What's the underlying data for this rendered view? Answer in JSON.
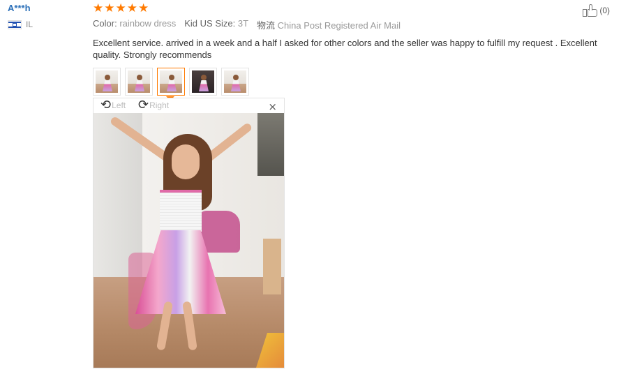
{
  "reviewer": {
    "name": "A***h",
    "country_code": "IL"
  },
  "review": {
    "rating": 5,
    "stars": [
      "★",
      "★",
      "★",
      "★",
      "★"
    ],
    "color_label": "Color:",
    "color_value": "rainbow dress",
    "size_label": "Kid US Size:",
    "size_value": "3T",
    "logistics_label": "物流",
    "logistics_value": "China Post Registered Air Mail",
    "text": "Excellent service. arrived in a week and a half I asked for other colors and the seller was happy to fulfill my request . Excellent quality. Strongly recommends",
    "helpful_count": "(0)"
  },
  "photos": {
    "thumbnails": [
      {
        "selected": false
      },
      {
        "selected": false
      },
      {
        "selected": true
      },
      {
        "selected": false
      },
      {
        "selected": false
      }
    ],
    "selected_index": 2
  },
  "viewer": {
    "rotate_left_label": "Left",
    "rotate_right_label": "Right",
    "close_glyph": "×",
    "rotate_left_glyph": "⟲",
    "rotate_right_glyph": "⟳"
  },
  "colors": {
    "accent": "#ff7a00",
    "username": "#2a6fb8"
  }
}
